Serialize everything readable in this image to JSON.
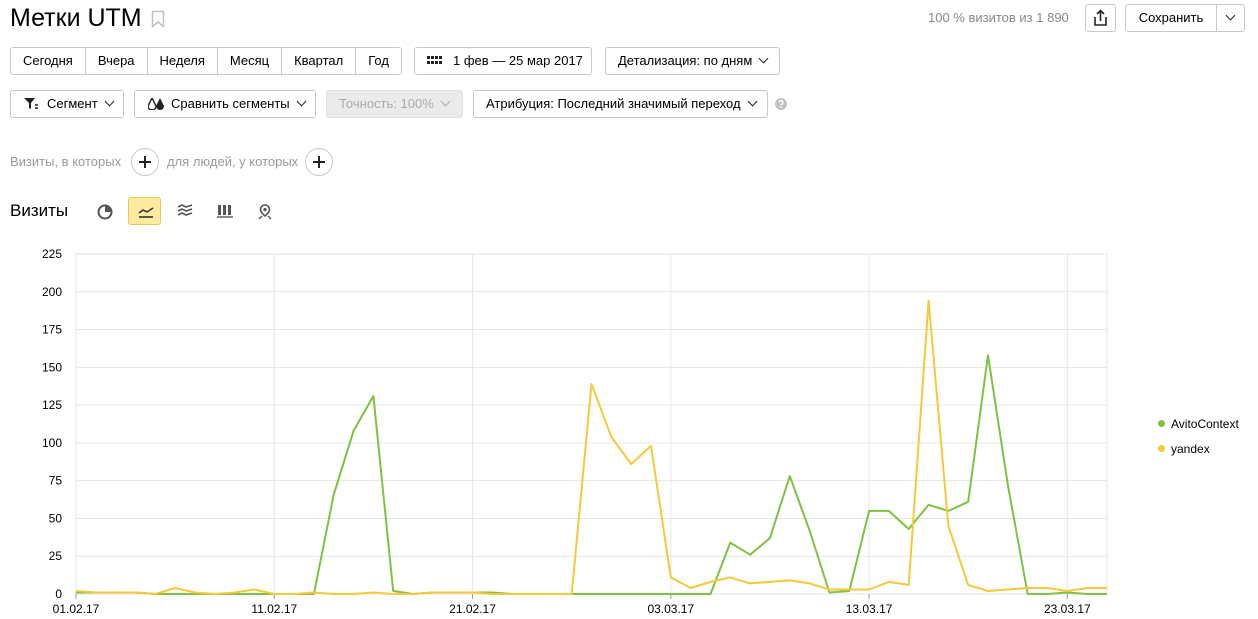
{
  "header": {
    "title": "Метки UTM",
    "visits_info": "100 % визитов из 1 890",
    "save_label": "Сохранить"
  },
  "periods": [
    "Сегодня",
    "Вчера",
    "Неделя",
    "Месяц",
    "Квартал",
    "Год"
  ],
  "date_range": "1 фев — 25 мар 2017",
  "detail": "Детализация: по дням",
  "filters": {
    "segment": "Сегмент",
    "compare": "Сравнить сегменты",
    "accuracy": "Точность: 100%",
    "attribution": "Атрибуция: Последний значимый переход"
  },
  "conditions": {
    "visits_label": "Визиты, в которых",
    "people_label": "для людей, у которых"
  },
  "section": {
    "title": "Визиты"
  },
  "colors": {
    "avito": "#7dc243",
    "yandex": "#f6c83a",
    "accent": "#ffeba0",
    "weekend_tick": "#cc0000"
  },
  "chart_data": {
    "type": "line",
    "x_ticks": [
      "01.02.17",
      "11.02.17",
      "21.02.17",
      "03.03.17",
      "13.03.17",
      "23.03.17"
    ],
    "x_ticks_red": [
      "11.02.17"
    ],
    "y_ticks": [
      0,
      25,
      50,
      75,
      100,
      125,
      150,
      175,
      200,
      225
    ],
    "ylim": [
      0,
      225
    ],
    "x": [
      "01.02.17",
      "02.02.17",
      "03.02.17",
      "04.02.17",
      "05.02.17",
      "06.02.17",
      "07.02.17",
      "08.02.17",
      "09.02.17",
      "10.02.17",
      "11.02.17",
      "12.02.17",
      "13.02.17",
      "14.02.17",
      "15.02.17",
      "16.02.17",
      "17.02.17",
      "18.02.17",
      "19.02.17",
      "20.02.17",
      "21.02.17",
      "22.02.17",
      "23.02.17",
      "24.02.17",
      "25.02.17",
      "26.02.17",
      "27.02.17",
      "28.02.17",
      "01.03.17",
      "02.03.17",
      "03.03.17",
      "04.03.17",
      "05.03.17",
      "06.03.17",
      "07.03.17",
      "08.03.17",
      "09.03.17",
      "10.03.17",
      "11.03.17",
      "12.03.17",
      "13.03.17",
      "14.03.17",
      "15.03.17",
      "16.03.17",
      "17.03.17",
      "18.03.17",
      "19.03.17",
      "20.03.17",
      "21.03.17",
      "22.03.17",
      "23.03.17",
      "24.03.17",
      "25.03.17"
    ],
    "series": [
      {
        "name": "AvitoContext",
        "color": "#7dc243",
        "values": [
          1,
          1,
          1,
          1,
          0,
          0,
          0,
          0,
          0,
          0,
          0,
          0,
          0,
          66,
          108,
          131,
          2,
          0,
          1,
          1,
          1,
          1,
          0,
          0,
          0,
          0,
          0,
          0,
          0,
          0,
          0,
          0,
          0,
          34,
          26,
          37,
          78,
          42,
          1,
          2,
          55,
          55,
          43,
          59,
          55,
          61,
          158,
          72,
          0,
          0,
          1,
          0,
          0
        ]
      },
      {
        "name": "yandex",
        "color": "#f6c83a",
        "values": [
          2,
          1,
          1,
          1,
          0,
          4,
          1,
          0,
          1,
          3,
          0,
          0,
          1,
          0,
          0,
          1,
          0,
          0,
          1,
          1,
          1,
          0,
          0,
          0,
          0,
          0,
          139,
          104,
          86,
          98,
          11,
          4,
          8,
          11,
          7,
          8,
          9,
          7,
          3,
          3,
          3,
          8,
          6,
          194,
          45,
          6,
          2,
          3,
          4,
          4,
          2,
          4,
          4
        ]
      }
    ]
  }
}
